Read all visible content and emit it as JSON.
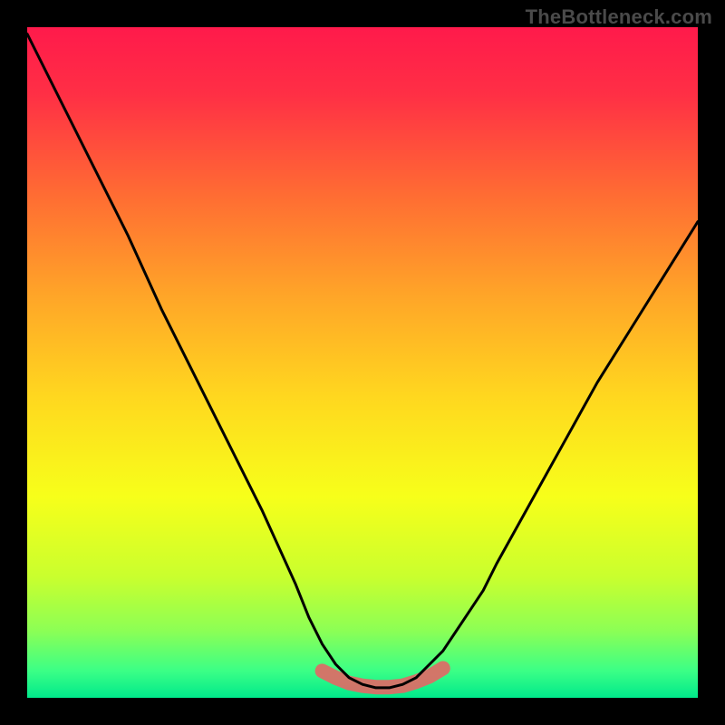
{
  "watermark": "TheBottleneck.com",
  "chart_data": {
    "type": "line",
    "title": "",
    "xlabel": "",
    "ylabel": "",
    "xlim": [
      0,
      100
    ],
    "ylim": [
      0,
      100
    ],
    "series": [
      {
        "name": "bottleneck-curve",
        "x": [
          0,
          5,
          10,
          15,
          20,
          25,
          30,
          35,
          40,
          42,
          44,
          46,
          48,
          50,
          52,
          54,
          56,
          58,
          60,
          62,
          64,
          66,
          68,
          70,
          75,
          80,
          85,
          90,
          95,
          100
        ],
        "y": [
          99,
          89,
          79,
          69,
          58,
          48,
          38,
          28,
          17,
          12,
          8,
          5,
          3,
          2,
          1.5,
          1.5,
          2,
          3,
          5,
          7,
          10,
          13,
          16,
          20,
          29,
          38,
          47,
          55,
          63,
          71
        ]
      },
      {
        "name": "optimal-band",
        "x": [
          44,
          46,
          48,
          50,
          52,
          54,
          56,
          58,
          60,
          62
        ],
        "y": [
          4,
          3,
          2.2,
          1.8,
          1.6,
          1.6,
          1.8,
          2.4,
          3.2,
          4.4
        ]
      }
    ],
    "gradient_stops": [
      {
        "offset": 0.0,
        "color": "#ff1a4b"
      },
      {
        "offset": 0.1,
        "color": "#ff2f45"
      },
      {
        "offset": 0.25,
        "color": "#ff6c33"
      },
      {
        "offset": 0.4,
        "color": "#ffa528"
      },
      {
        "offset": 0.55,
        "color": "#ffd71f"
      },
      {
        "offset": 0.7,
        "color": "#f7ff1a"
      },
      {
        "offset": 0.82,
        "color": "#c9ff2e"
      },
      {
        "offset": 0.9,
        "color": "#8cff55"
      },
      {
        "offset": 0.96,
        "color": "#3bff86"
      },
      {
        "offset": 1.0,
        "color": "#00e98b"
      }
    ],
    "band_color": "#e06a66",
    "curve_color": "#000000"
  }
}
